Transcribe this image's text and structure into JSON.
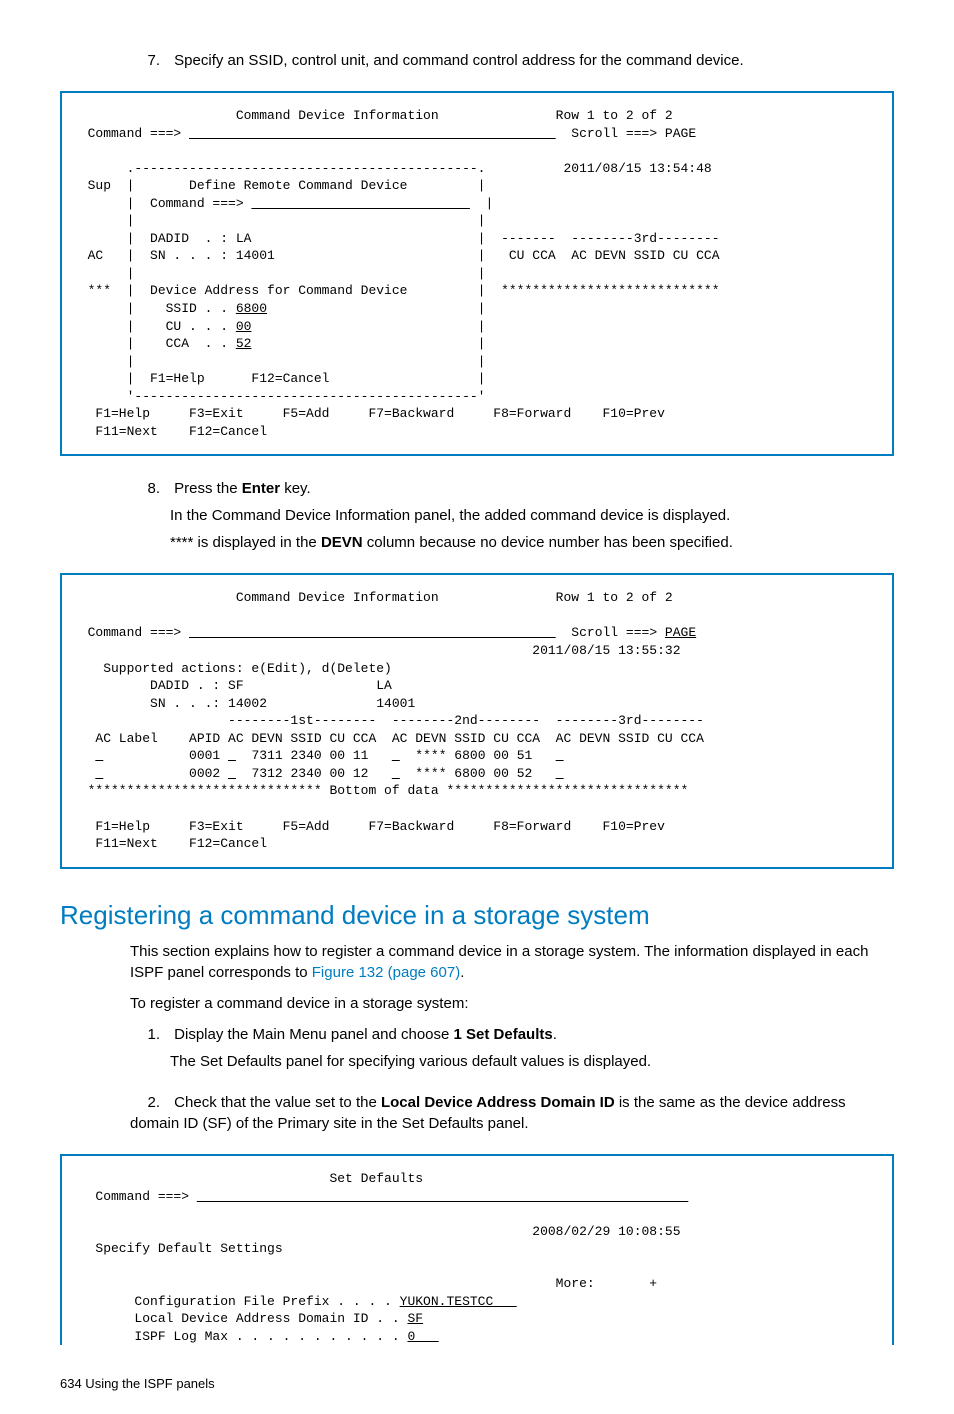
{
  "steps_top": {
    "num7": "7.",
    "text7": "Specify an SSID, control unit, and command control address for the command device."
  },
  "term1": {
    "l1": "                     Command Device Information               Row 1 to 2 of 2",
    "l2a": "  Command ===> ",
    "l2b": "                                               ",
    "l2c": "  Scroll ===> PAGE",
    "l3": "",
    "l4": "       .--------------------------------------------.          2011/08/15 13:54:48",
    "l5": "  Sup  |       Define Remote Command Device         |",
    "l6a": "       |  Command ===> ",
    "l6b": "                            ",
    "l6c": "  |",
    "l7": "       |                                            |",
    "l8": "       |  DADID  . : LA                             |  -------  --------3rd--------",
    "l9": "  AC   |  SN . . . : 14001                          |   CU CCA  AC DEVN SSID CU CCA",
    "l10": "       |                                            |",
    "l11": "  ***  |  Device Address for Command Device         |  ****************************",
    "l12a": "       |    SSID . . ",
    "l12b": "6800",
    "l12c": "                           |",
    "l13a": "       |    CU . . . ",
    "l13b": "00",
    "l13c": "                             |",
    "l14a": "       |    CCA  . . ",
    "l14b": "52",
    "l14c": "                             |",
    "l15": "       |                                            |",
    "l16": "       |  F1=Help      F12=Cancel                   |",
    "l17": "       '--------------------------------------------'",
    "l18": "   F1=Help     F3=Exit     F5=Add     F7=Backward     F8=Forward    F10=Prev",
    "l19": "   F11=Next    F12=Cancel"
  },
  "steps_mid": {
    "num8": "8.",
    "text8a": "Press the ",
    "text8b": "Enter",
    "text8c": " key.",
    "body8a": "In the Command Device Information panel, the added command device is displayed.",
    "body8b_a": "**** is displayed in the ",
    "body8b_b": "DEVN",
    "body8b_c": " column because no device number has been specified."
  },
  "term2": {
    "l1": "                     Command Device Information               Row 1 to 2 of 2",
    "l2": "",
    "l3a": "  Command ===> ",
    "l3b": "                                               ",
    "l3c": "  Scroll ===> ",
    "l3d": "PAGE",
    "l4": "                                                           2011/08/15 13:55:32",
    "l5": "    Supported actions: e(Edit), d(Delete)",
    "l6": "          DADID . : SF                 LA",
    "l7": "          SN . . .: 14002              14001",
    "l8": "                    --------1st--------  --------2nd--------  --------3rd--------",
    "l9": "   AC Label    APID AC DEVN SSID CU CCA  AC DEVN SSID CU CCA  AC DEVN SSID CU CCA",
    "l10a": "   ",
    "l10b": "_",
    "l10c": "           0001 ",
    "l10d": "_",
    "l10e": "  7311 2340 00 11   ",
    "l10f": "_",
    "l10g": "  **** 6800 00 51   ",
    "l10h": "_",
    "l11a": "   ",
    "l11b": "_",
    "l11c": "           0002 ",
    "l11d": "_",
    "l11e": "  7312 2340 00 12   ",
    "l11f": "_",
    "l11g": "  **** 6800 00 52   ",
    "l11h": "_",
    "l12": "  ****************************** Bottom of data *******************************",
    "l13": "",
    "l14": "   F1=Help     F3=Exit     F5=Add     F7=Backward     F8=Forward    F10=Prev",
    "l15": "   F11=Next    F12=Cancel"
  },
  "heading2": "Registering a command device in a storage system",
  "para1a": "This section explains how to register a command device in a storage system. The information displayed in each ISPF panel corresponds to ",
  "para1link": "Figure 132 (page 607)",
  "para1b": ".",
  "para2": "To register a command device in a storage system:",
  "ol": {
    "num1": "1.",
    "t1a": "Display the Main Menu panel and choose ",
    "t1b": "1 Set Defaults",
    "t1c": ".",
    "b1": "The Set Defaults panel for specifying various default values is displayed.",
    "num2": "2.",
    "t2a": "Check that the value set to the ",
    "t2b": "Local Device Address Domain ID",
    "t2c": " is the same as the device address domain ID (SF) of the Primary site in the Set Defaults panel."
  },
  "term3": {
    "l1": "                                 Set Defaults",
    "l2a": "   Command ===> ",
    "l2b": "                                                               ",
    "l3": "",
    "l4": "                                                           2008/02/29 10:08:55",
    "l5": "   Specify Default Settings",
    "l6": "",
    "l7": "                                                              More:       +",
    "l8a": "        Configuration File Prefix . . . . ",
    "l8b": "YUKON.TESTCC   ",
    "l9a": "        Local Device Address Domain ID . . ",
    "l9b": "SF",
    "l10a": "        ISPF Log Max . . . . . . . . . . . ",
    "l10b": "0   "
  },
  "footer": "634   Using the ISPF panels"
}
